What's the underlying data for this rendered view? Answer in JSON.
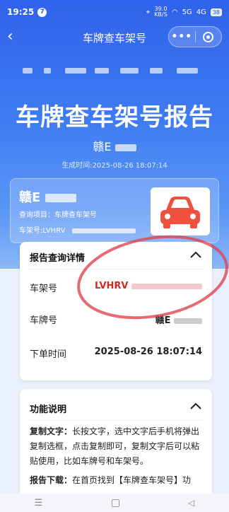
{
  "status_bar": {
    "time": "19:25",
    "notification_badge": "7",
    "net_speed_value": "39.0",
    "net_speed_unit": "KB/S",
    "signal_left": "5G",
    "signal_right": "4G",
    "battery": "38"
  },
  "nav": {
    "title": "车牌查车架号",
    "back_icon": "chevron-left-icon",
    "more_icon": "more-dots-icon",
    "close_icon": "target-circle-icon"
  },
  "hero": {
    "headline": "车牌查车架号报告",
    "plate_masked": "赣E",
    "generated_time": "生成时间:2025-08-26 18:07:14"
  },
  "vehicle_card": {
    "plate_prefix": "赣E",
    "query_item": "查询项目：车牌查车架号",
    "vin_label": "车架号:LVHRV",
    "car_icon": "car-icon"
  },
  "detail": {
    "title": "报告查询详情",
    "rows": [
      {
        "label": "车架号",
        "value": "LVHRV"
      },
      {
        "label": "车牌号",
        "value": "赣E"
      },
      {
        "label": "下单时间",
        "value": "2025-08-26 18:07:14"
      }
    ]
  },
  "functions": {
    "title": "功能说明",
    "p1_label": "复制文字：",
    "p1_text": "长按文字，选中文字后手机将弹出复制选框，点击复制即可，复制文字后可以粘贴使用，比如车牌号和车架号。",
    "p2_label": "报告下载：",
    "p2_text": "在首页找到【车牌查车架号】功"
  },
  "colors": {
    "primary_blue": "#2f62ea",
    "accent_red": "#d62626",
    "car_icon_color": "#f0503e"
  }
}
